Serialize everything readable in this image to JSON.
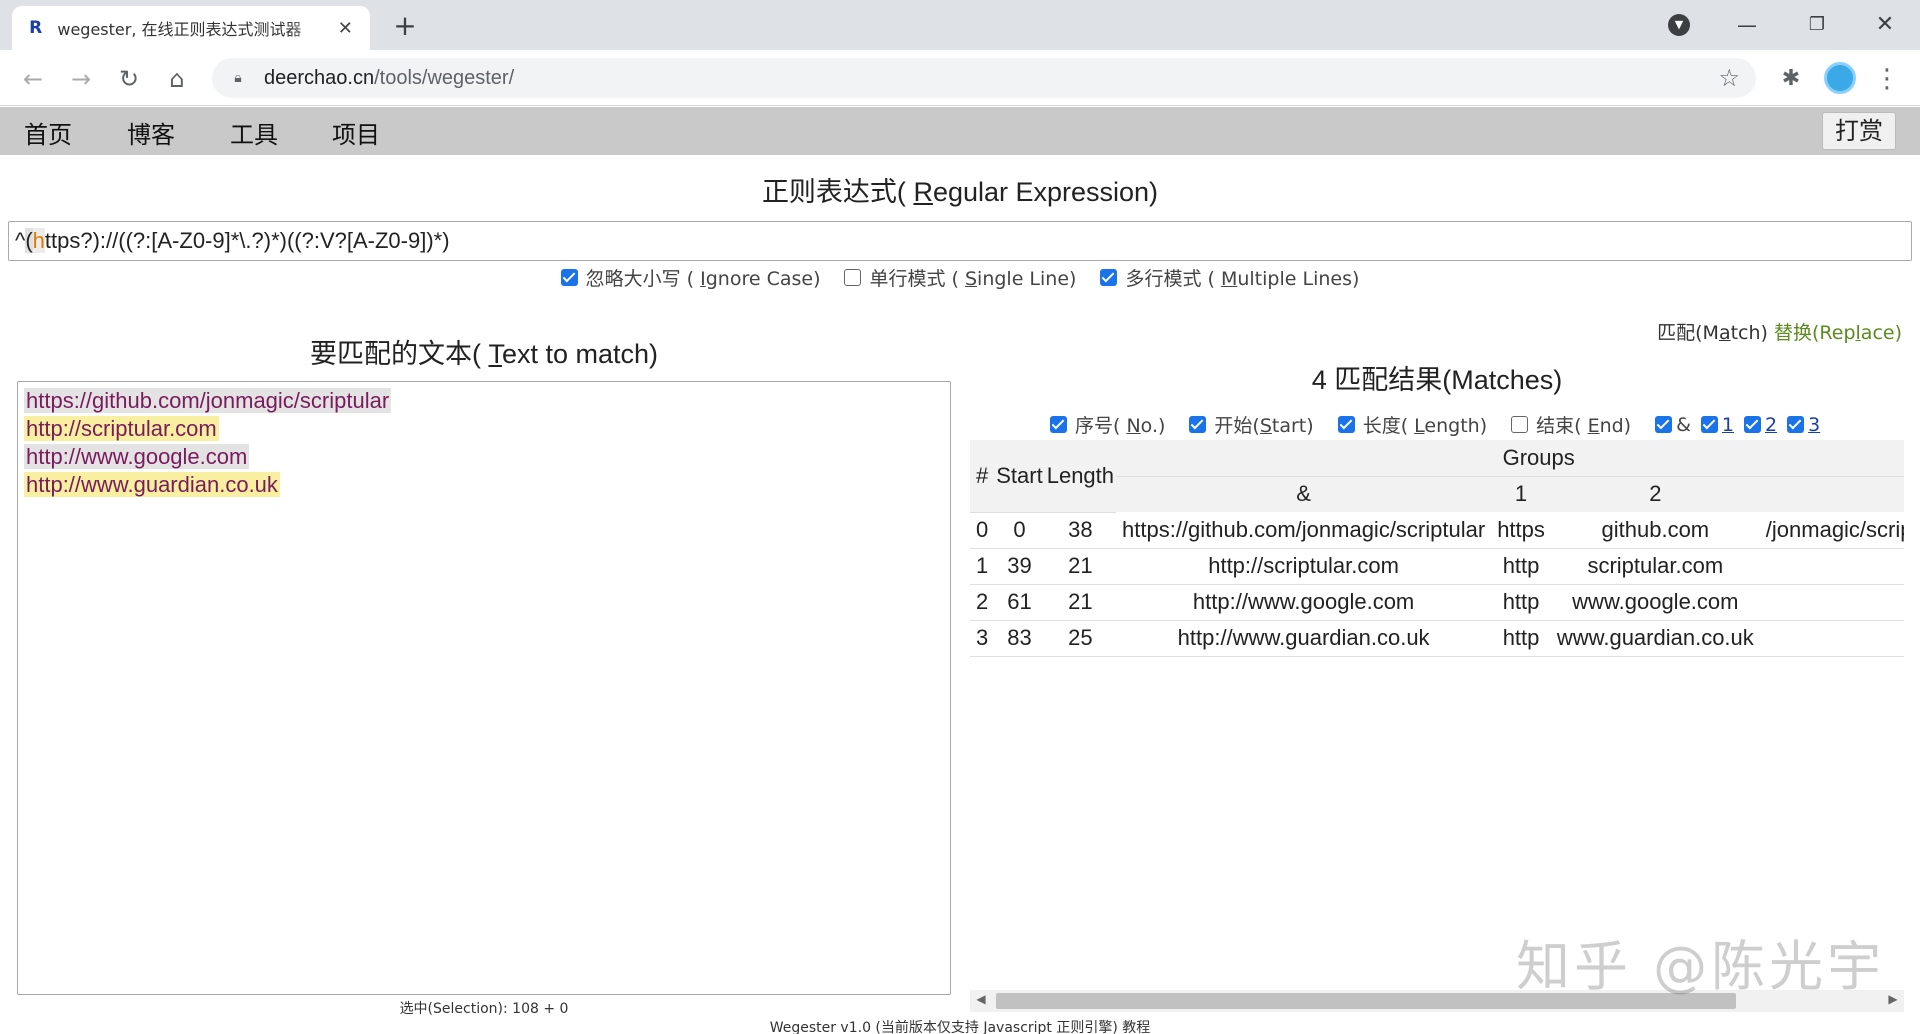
{
  "browser": {
    "tab_title": "wegester, 在线正则表达式测试器",
    "tab_favicon": "R",
    "url_host": "deerchao.cn",
    "url_path": "/tools/wegester/",
    "new_tab": "+"
  },
  "nav": {
    "items": [
      "首页",
      "博客",
      "工具",
      "项目"
    ],
    "donate": "打赏"
  },
  "regex": {
    "title_prefix": "正则表达式( ",
    "title_key": "R",
    "title_rest": "egular Expression)",
    "pre1": "^",
    "hl1": "(",
    "hl2": "h",
    "post": "ttps?)://((?:[A-Z0-9]*\\.?)*)((?:V?[A-Z0-9])*)",
    "options": [
      {
        "checked": true,
        "prefix": "忽略大小写 ( ",
        "key": "I",
        "rest": "gnore Case)"
      },
      {
        "checked": false,
        "prefix": "单行模式 ( ",
        "key": "S",
        "rest": "ingle Line)"
      },
      {
        "checked": true,
        "prefix": "多行模式 ( ",
        "key": "M",
        "rest": "ultiple Lines)"
      }
    ]
  },
  "text_panel": {
    "title_prefix": "要匹配的文本( ",
    "title_key": "T",
    "title_rest": "ext to match)",
    "lines": [
      "https://github.com/jonmagic/scriptular",
      "http://scriptular.com",
      "http://www.google.com",
      "http://www.guardian.co.uk"
    ],
    "selection": "选中(Selection): 108 + 0"
  },
  "mode": {
    "match_prefix": "匹配(M",
    "match_key": "a",
    "match_rest": "tch)",
    "replace_prefix": "替换(Rep",
    "replace_key": "l",
    "replace_rest": "ace)"
  },
  "results": {
    "title": "4 匹配结果(Matches)",
    "col_options": [
      {
        "checked": true,
        "prefix": "序号( ",
        "key": "N",
        "rest": "o.)"
      },
      {
        "checked": true,
        "prefix": "开始(",
        "key": "S",
        "rest": "tart)"
      },
      {
        "checked": true,
        "prefix": "长度( ",
        "key": "L",
        "rest": "ength)"
      },
      {
        "checked": false,
        "prefix": "结束( ",
        "key": "E",
        "rest": "nd)"
      }
    ],
    "group_options": [
      {
        "checked": true,
        "label": "&"
      },
      {
        "checked": true,
        "label": "1"
      },
      {
        "checked": true,
        "label": "2"
      },
      {
        "checked": true,
        "label": "3"
      }
    ],
    "headers": {
      "no": "#",
      "start": "Start",
      "length": "Length",
      "groups": "Groups",
      "g_all": "&",
      "g1": "1",
      "g2": "2"
    },
    "rows": [
      {
        "no": "0",
        "start": "0",
        "length": "38",
        "all": "https://github.com/jonmagic/scriptular",
        "g1": "https",
        "g2": "github.com",
        "g3": "/jonmagic/scriptular"
      },
      {
        "no": "1",
        "start": "39",
        "length": "21",
        "all": "http://scriptular.com",
        "g1": "http",
        "g2": "scriptular.com",
        "g3": ""
      },
      {
        "no": "2",
        "start": "61",
        "length": "21",
        "all": "http://www.google.com",
        "g1": "http",
        "g2": "www.google.com",
        "g3": ""
      },
      {
        "no": "3",
        "start": "83",
        "length": "25",
        "all": "http://www.guardian.co.uk",
        "g1": "http",
        "g2": "www.guardian.co.uk",
        "g3": ""
      }
    ]
  },
  "footer": "Wegester v1.0 (当前版本仅支持 Javascript 正则引擎) 教程",
  "watermark": "知乎 @陈光宇"
}
